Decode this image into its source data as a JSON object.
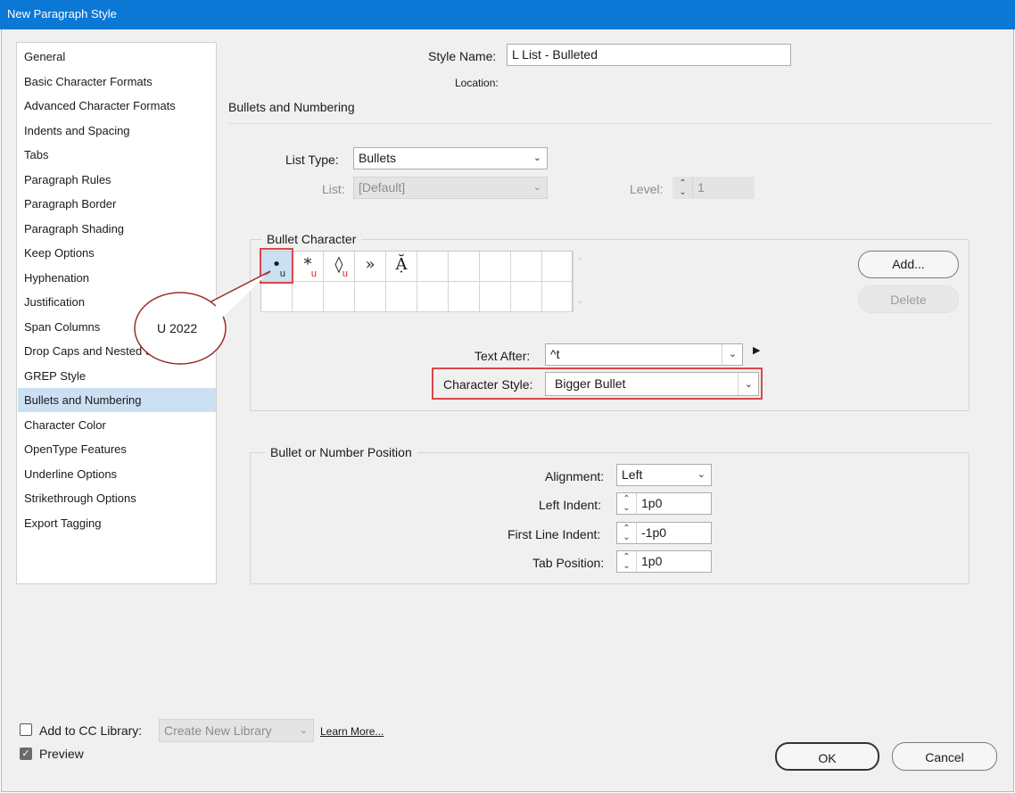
{
  "window": {
    "title": "New Paragraph Style"
  },
  "sidebar": {
    "items": [
      {
        "label": "General"
      },
      {
        "label": "Basic Character Formats"
      },
      {
        "label": "Advanced Character Formats"
      },
      {
        "label": "Indents and Spacing"
      },
      {
        "label": "Tabs"
      },
      {
        "label": "Paragraph Rules"
      },
      {
        "label": "Paragraph Border"
      },
      {
        "label": "Paragraph Shading"
      },
      {
        "label": "Keep Options"
      },
      {
        "label": "Hyphenation"
      },
      {
        "label": "Justification"
      },
      {
        "label": "Span Columns"
      },
      {
        "label": "Drop Caps and Nested Styles"
      },
      {
        "label": "GREP Style"
      },
      {
        "label": "Bullets and Numbering"
      },
      {
        "label": "Character Color"
      },
      {
        "label": "OpenType Features"
      },
      {
        "label": "Underline Options"
      },
      {
        "label": "Strikethrough Options"
      },
      {
        "label": "Export Tagging"
      }
    ],
    "selected": "Bullets and Numbering"
  },
  "header": {
    "style_name_label": "Style Name:",
    "style_name_value": "L List - Bulleted",
    "location_label": "Location:",
    "section_title": "Bullets and Numbering"
  },
  "list": {
    "type_label": "List Type:",
    "type_value": "Bullets",
    "list_label": "List:",
    "list_value": "[Default]",
    "level_label": "Level:",
    "level_value": "1"
  },
  "bullet_character": {
    "group_title": "Bullet Character",
    "glyphs": [
      {
        "char": "•",
        "marker": "u"
      },
      {
        "char": "*",
        "marker": "u"
      },
      {
        "char": "◊",
        "marker": "u"
      },
      {
        "char": "»",
        "marker": ""
      },
      {
        "char": "Ặ",
        "marker": ""
      }
    ],
    "callout_text": "U 2022",
    "add_label": "Add...",
    "delete_label": "Delete",
    "text_after_label": "Text After:",
    "text_after_value": "^t",
    "char_style_label": "Character Style:",
    "char_style_value": "Bigger Bullet"
  },
  "position": {
    "group_title": "Bullet or Number Position",
    "alignment_label": "Alignment:",
    "alignment_value": "Left",
    "left_indent_label": "Left Indent:",
    "left_indent_value": "1p0",
    "first_line_indent_label": "First Line Indent:",
    "first_line_indent_value": "-1p0",
    "tab_position_label": "Tab Position:",
    "tab_position_value": "1p0"
  },
  "footer": {
    "cc_library_label": "Add to CC Library:",
    "cc_library_value": "Create New Library",
    "learn_more": "Learn More...",
    "preview_label": "Preview",
    "preview_checked": true,
    "ok_label": "OK",
    "cancel_label": "Cancel"
  },
  "colors": {
    "titlebar": "#0a78d4",
    "highlight_box": "#d9474b",
    "selected_item": "#cce0f4"
  }
}
